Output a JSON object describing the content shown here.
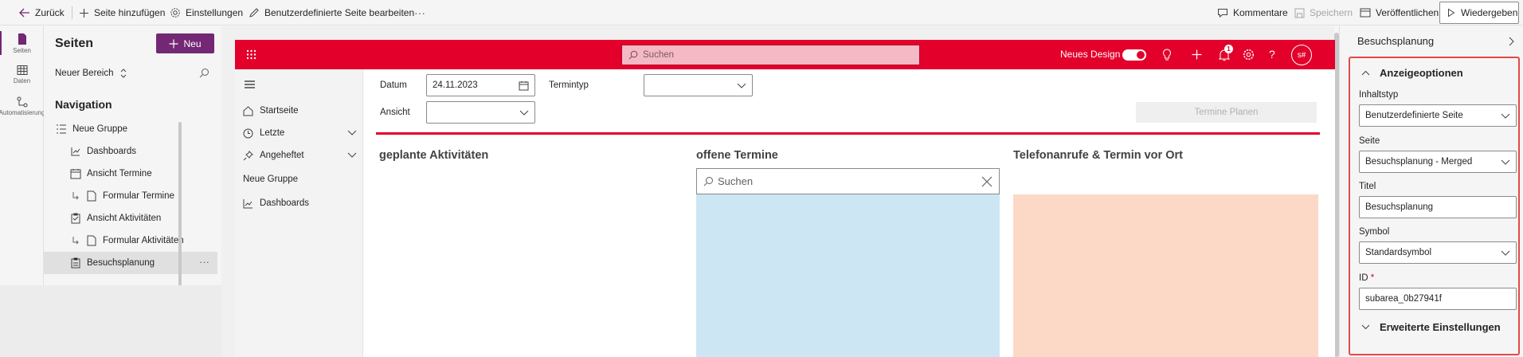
{
  "toolbar": {
    "back": "Zurück",
    "add_page": "Seite hinzufügen",
    "settings": "Einstellungen",
    "edit_custom_page": "Benutzerdefinierte Seite bearbeiten",
    "more": "···",
    "comments": "Kommentare",
    "save": "Speichern",
    "publish": "Veröffentlichen",
    "play": "Wiedergeben"
  },
  "rail": {
    "items": [
      {
        "label": "Seiten",
        "icon": "page-icon"
      },
      {
        "label": "Daten",
        "icon": "table-icon"
      },
      {
        "label": "Automatisierung",
        "icon": "flow-icon"
      }
    ]
  },
  "pages_panel": {
    "title": "Seiten",
    "new_button": "Neu",
    "area": "Neuer Bereich",
    "navigation_title": "Navigation",
    "items": [
      {
        "label": "Neue Gruppe",
        "icon": "group-icon"
      },
      {
        "label": "Dashboards",
        "icon": "dashboard-icon"
      },
      {
        "label": "Ansicht Termine",
        "icon": "calendar-icon"
      },
      {
        "label": "Formular Termine",
        "icon": "form-icon"
      },
      {
        "label": "Ansicht Aktivitäten",
        "icon": "clipboard-icon"
      },
      {
        "label": "Formular Aktivitäten",
        "icon": "form-icon"
      },
      {
        "label": "Besuchsplanung",
        "icon": "custom-page-icon",
        "selected": true
      }
    ],
    "selected_more": "···"
  },
  "app": {
    "search_placeholder": "Suchen",
    "new_design_label": "Neues Design",
    "notification_count": "1",
    "avatar": "s#",
    "sitemap": {
      "items": [
        {
          "label": "Startseite",
          "icon": "home-icon"
        },
        {
          "label": "Letzte",
          "icon": "clock-icon",
          "expandable": true
        },
        {
          "label": "Angeheftet",
          "icon": "pin-icon",
          "expandable": true
        }
      ],
      "group": "Neue Gruppe",
      "group_items": [
        {
          "label": "Dashboards",
          "icon": "dashboard-icon"
        }
      ]
    },
    "filters": {
      "date_label": "Datum",
      "date_value": "24.11.2023",
      "type_label": "Termintyp",
      "type_value": "",
      "view_label": "Ansicht",
      "view_value": "",
      "plan_button": "Termine Planen"
    },
    "columns": {
      "planned": "geplante Aktivitäten",
      "open": "offene Termine",
      "open_search_placeholder": "Suchen",
      "calls": "Telefonanrufe & Termin vor Ort"
    },
    "colors": {
      "accent": "#e3002b",
      "open_box": "#cce6f4",
      "calls_box": "#fcd9c6"
    }
  },
  "properties": {
    "title": "Besuchsplanung",
    "section": "Anzeigeoptionen",
    "content_type_label": "Inhaltstyp",
    "content_type_value": "Benutzerdefinierte Seite",
    "page_label": "Seite",
    "page_value": "Besuchsplanung - Merged",
    "title_label": "Titel",
    "title_value": "Besuchsplanung",
    "symbol_label": "Symbol",
    "symbol_value": "Standardsymbol",
    "id_label": "ID",
    "id_required": "*",
    "id_value": "subarea_0b27941f",
    "advanced": "Erweiterte Einstellungen"
  }
}
